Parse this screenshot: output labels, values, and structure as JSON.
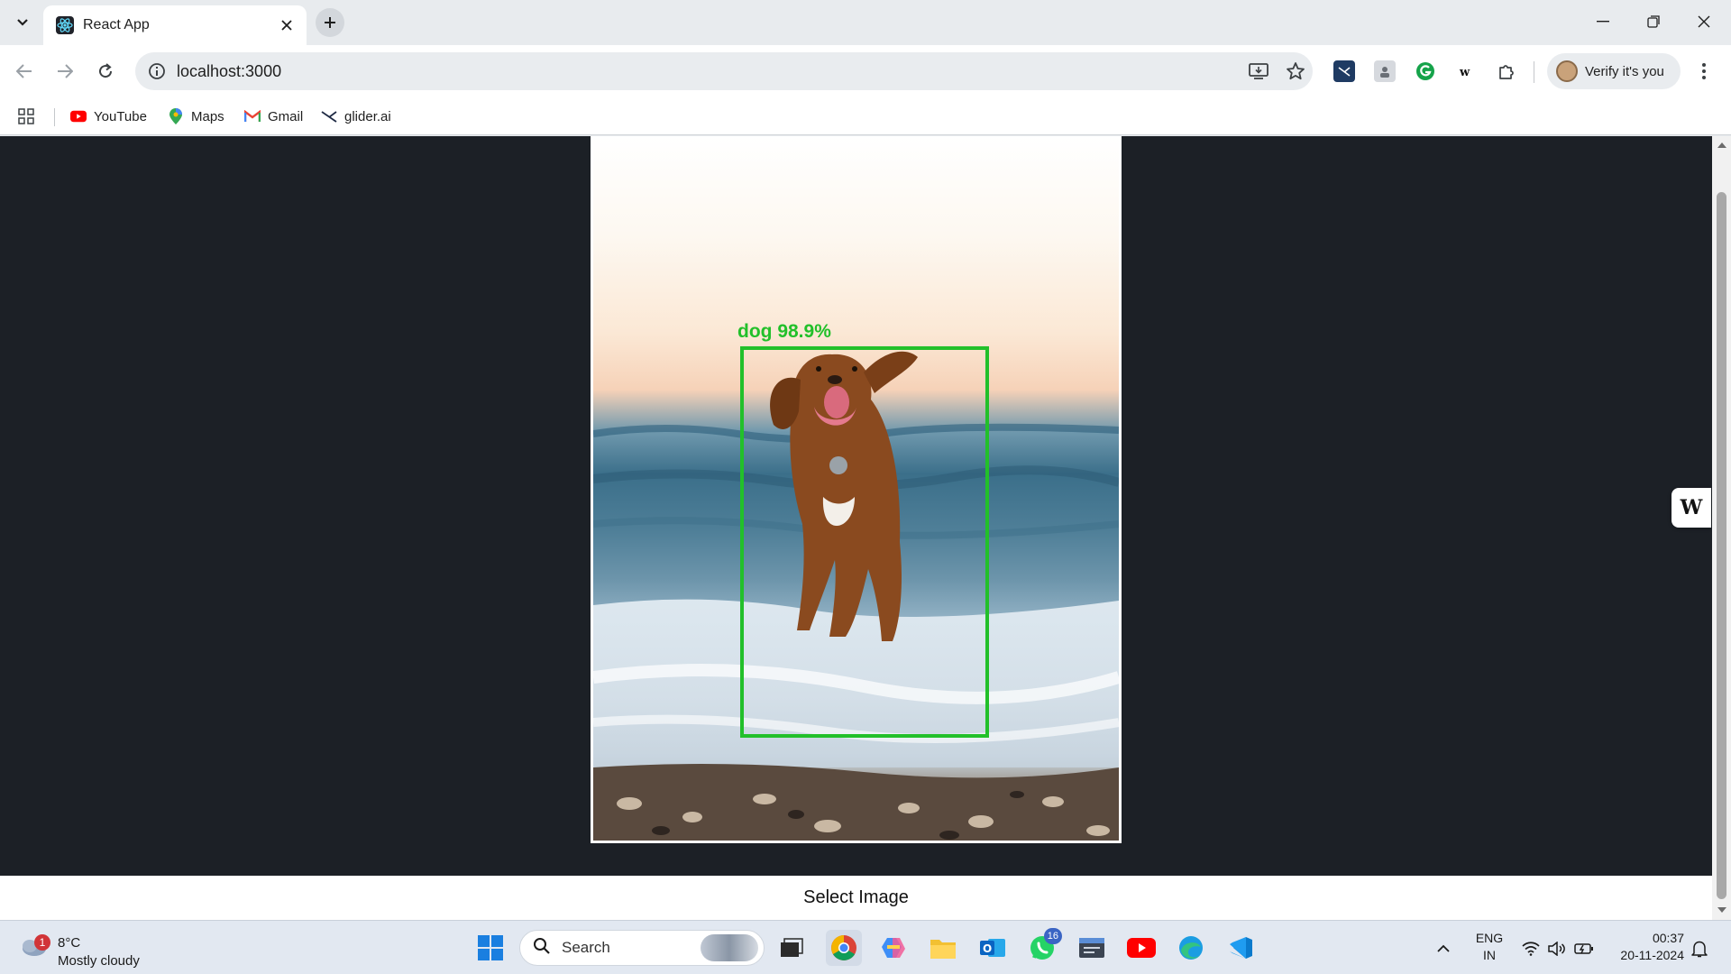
{
  "browser": {
    "tab": {
      "title": "React App"
    },
    "address_bar": {
      "url": "localhost:3000"
    },
    "profile": {
      "label": "Verify it's you"
    },
    "bookmarks": [
      {
        "label": "YouTube",
        "icon": "youtube-icon"
      },
      {
        "label": "Maps",
        "icon": "maps-icon"
      },
      {
        "label": "Gmail",
        "icon": "gmail-icon"
      },
      {
        "label": "glider.ai",
        "icon": "glider-icon"
      }
    ],
    "extensions": [
      "glider-extension-icon",
      "profile-extension-icon",
      "grammarly-icon",
      "wordtune-icon",
      "puzzle-icon"
    ]
  },
  "app": {
    "detection": {
      "label": "dog 98.9%",
      "color": "#22c02a"
    },
    "select_button": {
      "label": "Select Image"
    },
    "floating_widget": {
      "label": "W"
    }
  },
  "taskbar": {
    "weather": {
      "temp": "8°C",
      "desc": "Mostly cloudy",
      "badge": "1"
    },
    "search": {
      "label": "Search"
    },
    "whatsapp_badge": "16",
    "language": {
      "line1": "ENG",
      "line2": "IN"
    },
    "clock": {
      "time": "00:37",
      "date": "20-11-2024"
    }
  }
}
